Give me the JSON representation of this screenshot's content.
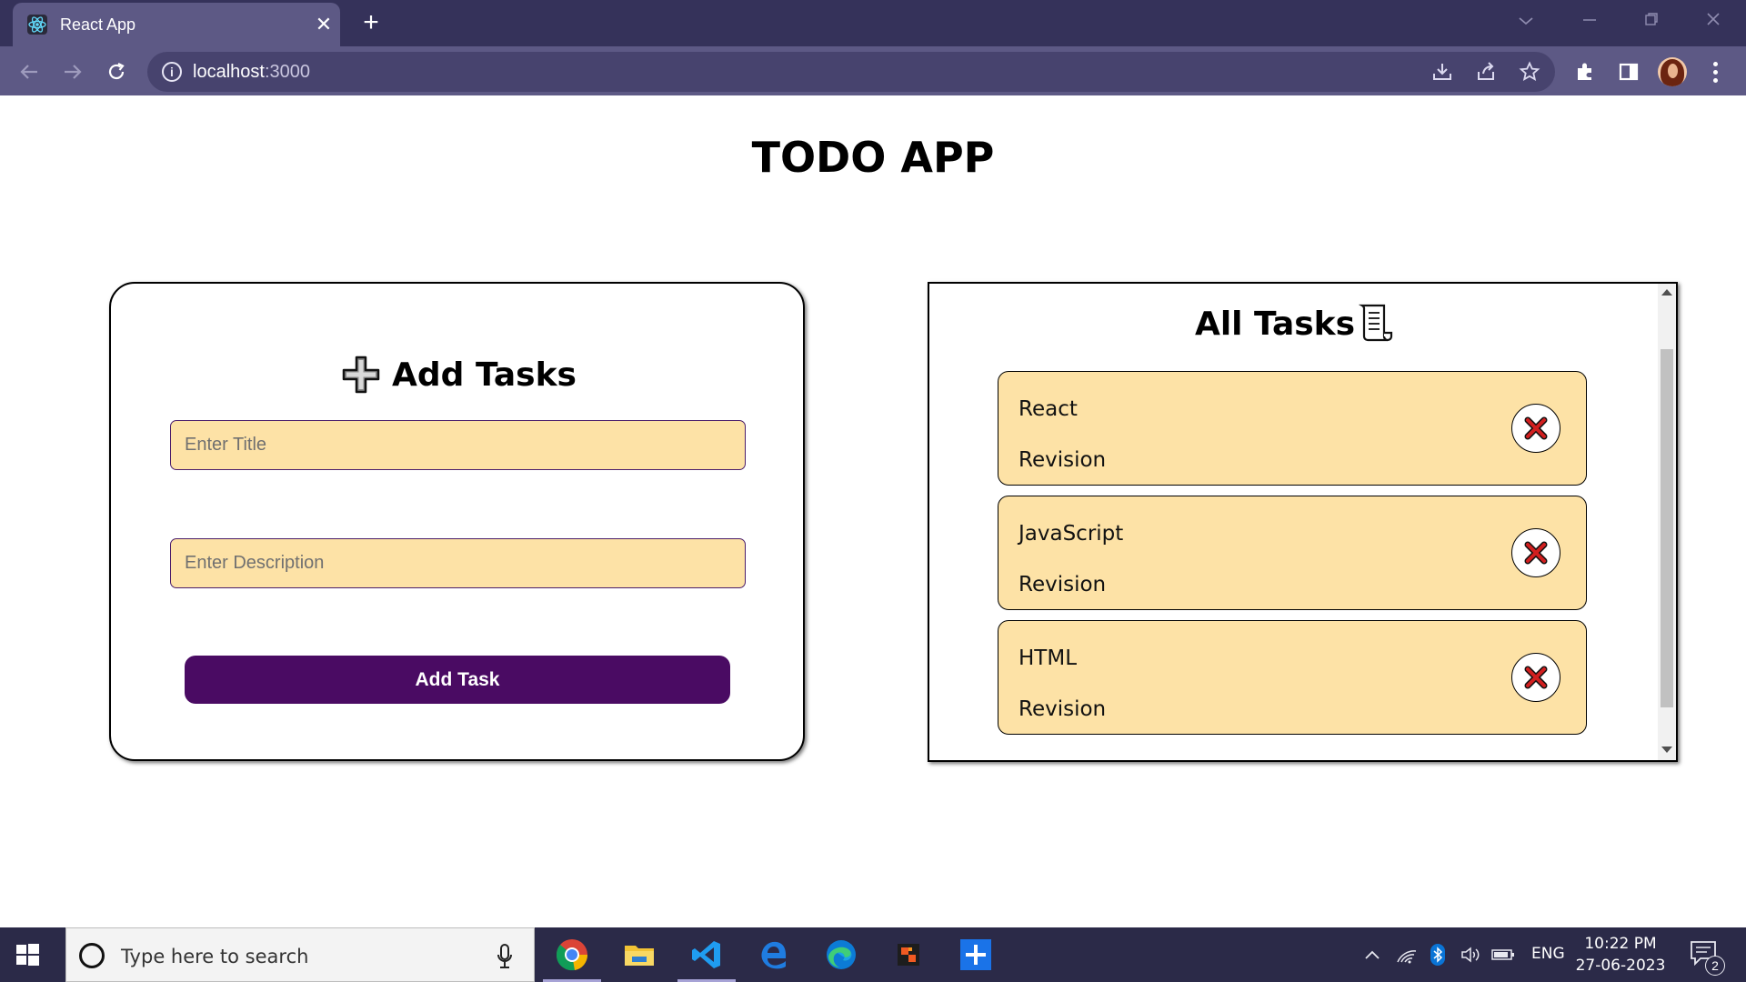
{
  "browser": {
    "tab_title": "React App",
    "url_host": "localhost",
    "url_port": ":3000",
    "new_tab_symbol": "+",
    "close_symbol": "✕"
  },
  "page": {
    "title": "TODO APP"
  },
  "add_form": {
    "heading": "Add Tasks",
    "title_placeholder": "Enter Title",
    "description_placeholder": "Enter Description",
    "button_label": "Add Task"
  },
  "tasks_panel": {
    "heading": "All Tasks",
    "tasks": [
      {
        "title": "React",
        "description": "Revision"
      },
      {
        "title": "JavaScript",
        "description": "Revision"
      },
      {
        "title": "HTML",
        "description": "Revision"
      }
    ]
  },
  "taskbar": {
    "search_placeholder": "Type here to search",
    "language": "ENG",
    "time": "10:22 PM",
    "date": "27-06-2023",
    "notification_count": "2"
  },
  "colors": {
    "accent_button": "#4a0b63",
    "input_fill": "#fde2a6",
    "delete_icon": "#cc1b1b",
    "chrome_dark": "#35325a",
    "chrome_tab": "#5d5985"
  },
  "icons": [
    "react-logo-icon",
    "plus-icon",
    "scroll-icon",
    "close-x-icon",
    "windows-icon",
    "chrome-icon",
    "folder-icon",
    "vscode-icon",
    "edge-icon"
  ]
}
